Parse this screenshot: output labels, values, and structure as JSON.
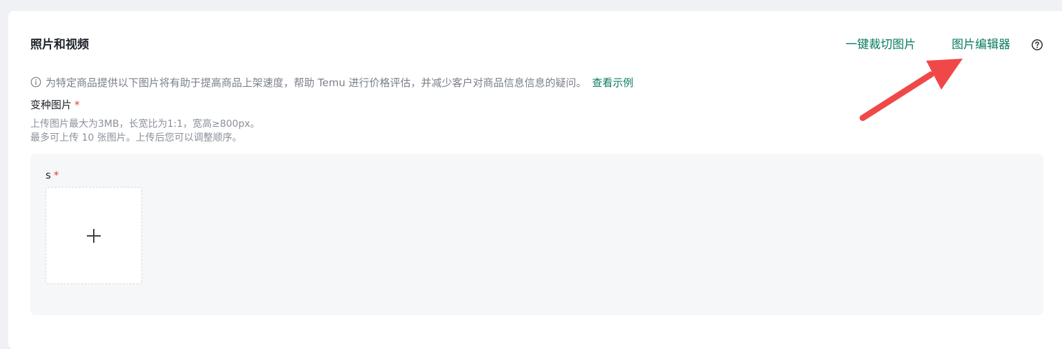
{
  "section": {
    "title": "照片和视频",
    "crop_link": "一键裁切图片",
    "editor_link": "图片编辑器",
    "help_icon": "question-circle-icon"
  },
  "info": {
    "icon": "info-circle-icon",
    "text": "为特定商品提供以下图片将有助于提高商品上架速度，帮助 Temu 进行价格评估，并减少客户对商品信息信息的疑问。",
    "example_link": "查看示例"
  },
  "variant_images": {
    "label": "变种图片",
    "required_mark": "*",
    "hint_line1": "上传图片最大为3MB，长宽比为1:1，宽高≥800px。",
    "hint_line2": "最多可上传 10 张图片。上传后您可以调整顺序。"
  },
  "variant_panel": {
    "variant_name": "s",
    "required_mark": "*",
    "upload_icon": "plus-icon"
  },
  "annotation": {
    "arrow_color": "#f04848",
    "icon": "arrow-annotation-icon"
  },
  "colors": {
    "accent": "#0a7b60",
    "required": "#e83b3b"
  }
}
